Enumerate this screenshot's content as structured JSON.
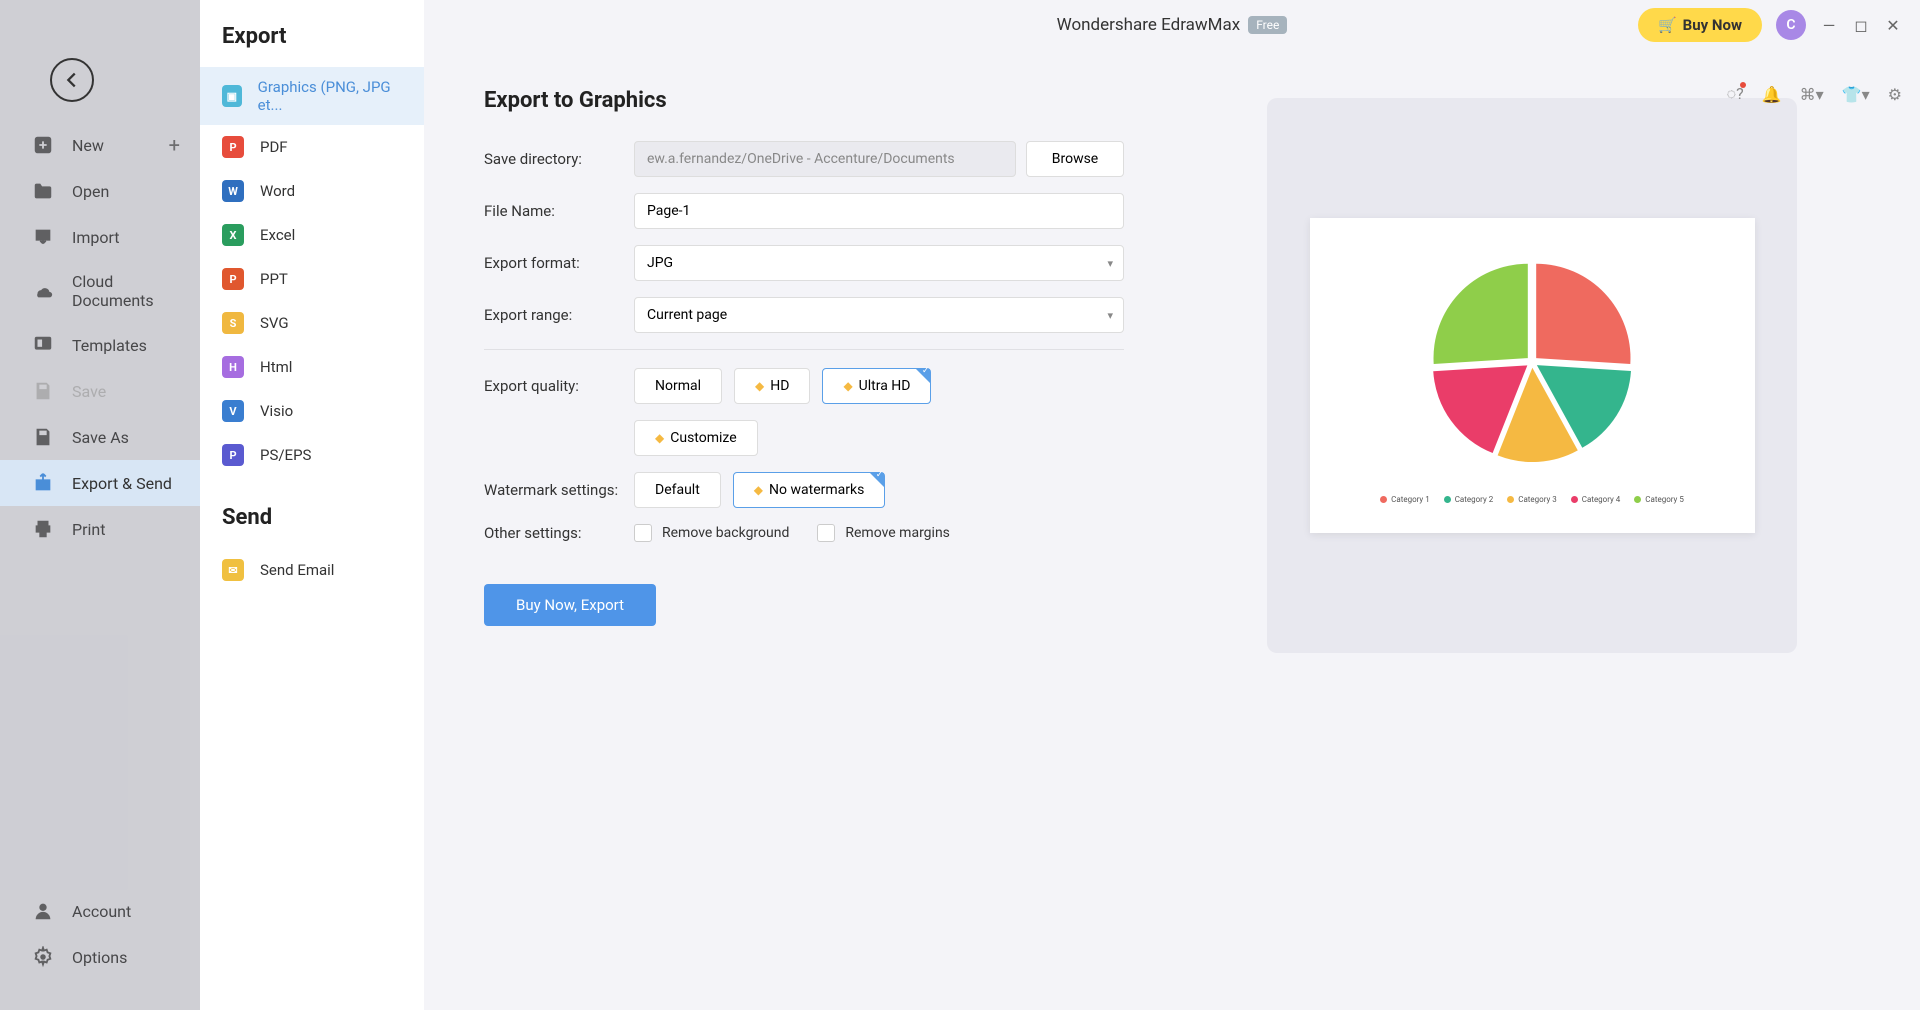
{
  "app": {
    "title": "Wondershare EdrawMax",
    "badge": "Free"
  },
  "titlebar": {
    "buy": "Buy Now",
    "avatar": "C"
  },
  "sidebar": {
    "items": [
      {
        "label": "New"
      },
      {
        "label": "Open"
      },
      {
        "label": "Import"
      },
      {
        "label": "Cloud Documents"
      },
      {
        "label": "Templates"
      },
      {
        "label": "Save"
      },
      {
        "label": "Save As"
      },
      {
        "label": "Export & Send"
      },
      {
        "label": "Print"
      }
    ],
    "bottom": [
      {
        "label": "Account"
      },
      {
        "label": "Options"
      }
    ]
  },
  "formats": {
    "export_h": "Export",
    "send_h": "Send",
    "items": [
      {
        "label": "Graphics (PNG, JPG et...",
        "color": "#4fb8d8"
      },
      {
        "label": "PDF",
        "color": "#e74c3c"
      },
      {
        "label": "Word",
        "color": "#2f6fbf"
      },
      {
        "label": "Excel",
        "color": "#2a9d5e"
      },
      {
        "label": "PPT",
        "color": "#e0572e"
      },
      {
        "label": "SVG",
        "color": "#f0b840"
      },
      {
        "label": "Html",
        "color": "#a66de0"
      },
      {
        "label": "Visio",
        "color": "#3a7ed0"
      },
      {
        "label": "PS/EPS",
        "color": "#5a5ad0"
      }
    ],
    "send_items": [
      {
        "label": "Send Email",
        "color": "#f0c040"
      }
    ]
  },
  "form": {
    "heading": "Export to Graphics",
    "labels": {
      "dir": "Save directory:",
      "fname": "File Name:",
      "fmt": "Export format:",
      "range": "Export range:",
      "quality": "Export quality:",
      "wm": "Watermark settings:",
      "other": "Other settings:"
    },
    "values": {
      "dir": "ew.a.fernandez/OneDrive - Accenture/Documents",
      "fname": "Page-1",
      "fmt": "JPG",
      "range": "Current page"
    },
    "browse": "Browse",
    "quality_opts": {
      "normal": "Normal",
      "hd": "HD",
      "uhd": "Ultra HD",
      "custom": "Customize"
    },
    "wm_opts": {
      "def": "Default",
      "none": "No watermarks"
    },
    "other_opts": {
      "bg": "Remove background",
      "margins": "Remove margins"
    },
    "submit": "Buy Now, Export"
  },
  "chart_data": {
    "type": "pie",
    "categories": [
      "Category 1",
      "Category 2",
      "Category 3",
      "Category 4",
      "Category 5"
    ],
    "values": [
      26,
      16,
      14,
      18,
      26
    ],
    "colors": [
      "#ef6a5f",
      "#34b58d",
      "#f5b942",
      "#ea3d69",
      "#8fce4a"
    ],
    "title": "",
    "legend_position": "bottom"
  }
}
